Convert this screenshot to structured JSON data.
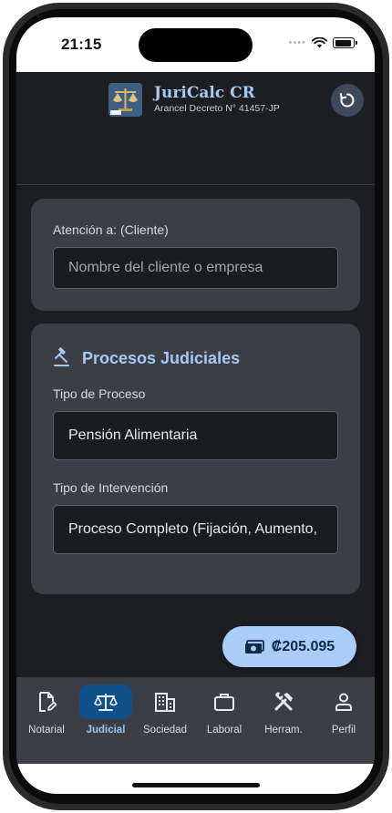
{
  "status": {
    "time": "21:15"
  },
  "header": {
    "title": "JuriCalc CR",
    "subtitle": "Arancel Decreto N° 41457-JP"
  },
  "client": {
    "label": "Atención a: (Cliente)",
    "placeholder": "Nombre del cliente o empresa"
  },
  "judicial": {
    "section_title": "Procesos Judiciales",
    "process_label": "Tipo de Proceso",
    "process_value": "Pensión Alimentaria",
    "intervention_label": "Tipo de Intervención",
    "intervention_value": "Proceso Completo (Fijación, Aumento,"
  },
  "total": {
    "amount": "₡205.095"
  },
  "nav": [
    {
      "label": "Notarial",
      "icon": "notarial-document-icon"
    },
    {
      "label": "Judicial",
      "icon": "scales-icon",
      "active": true
    },
    {
      "label": "Sociedad",
      "icon": "building-icon"
    },
    {
      "label": "Laboral",
      "icon": "briefcase-icon"
    },
    {
      "label": "Herram.",
      "icon": "tools-icon"
    },
    {
      "label": "Perfil",
      "icon": "person-icon"
    }
  ],
  "colors": {
    "accent": "#a9c9f5",
    "active_nav": "#0f5088",
    "card": "#3b3e45",
    "background": "#1d1e21"
  }
}
